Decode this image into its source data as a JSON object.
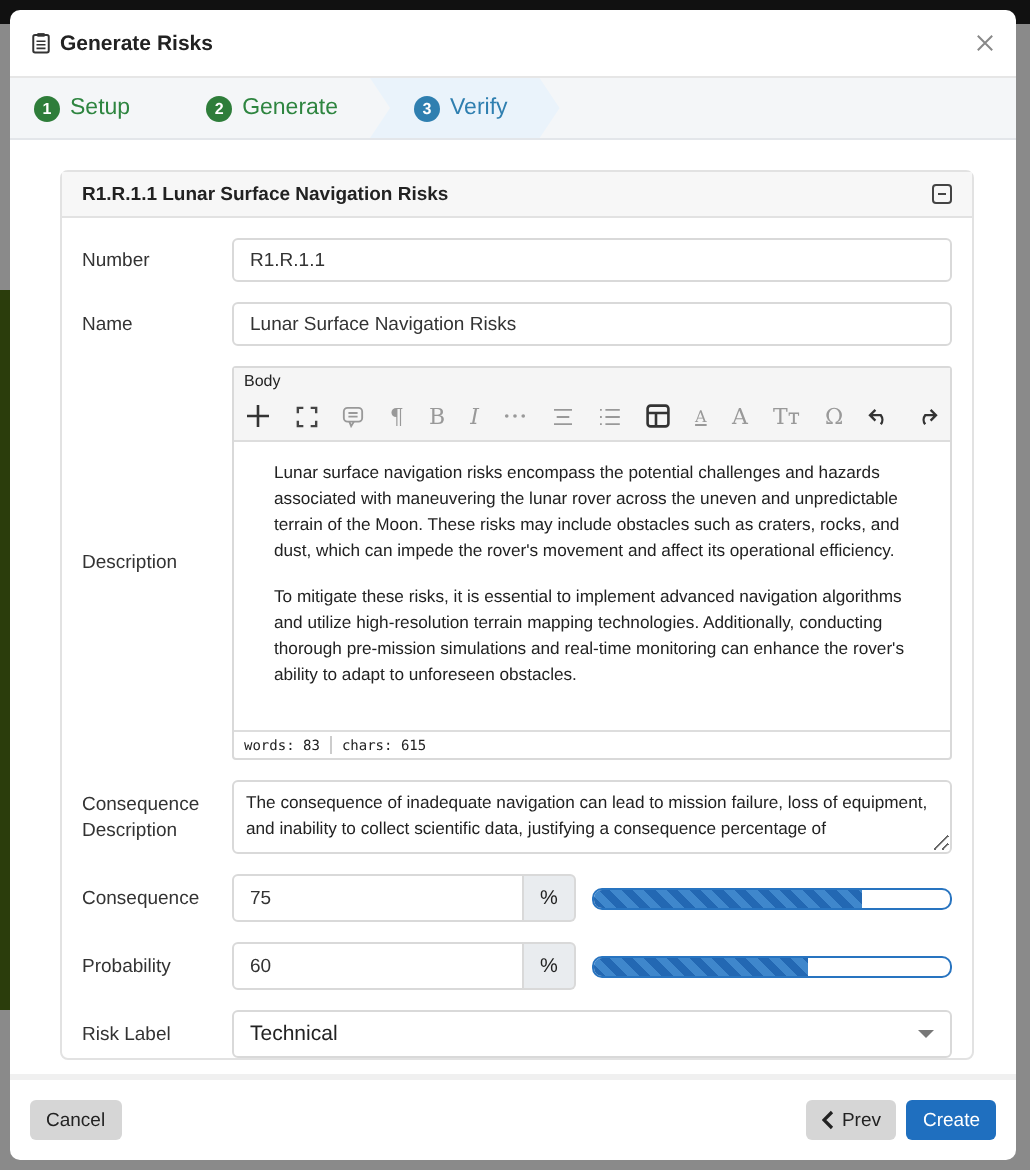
{
  "modal": {
    "title": "Generate Risks"
  },
  "steps": [
    {
      "number": "1",
      "label": "Setup",
      "selected": false
    },
    {
      "number": "2",
      "label": "Generate",
      "selected": false
    },
    {
      "number": "3",
      "label": "Verify",
      "selected": true
    }
  ],
  "card": {
    "title": "R1.R.1.1 Lunar Surface Navigation Risks",
    "expanded": true
  },
  "fields": {
    "number": {
      "label": "Number",
      "value": "R1.R.1.1"
    },
    "name": {
      "label": "Name",
      "value": "Lunar Surface Navigation Risks"
    },
    "description": {
      "label": "Description",
      "editor_label": "Body",
      "toolbar": [
        {
          "kind": "plus"
        },
        {
          "kind": "expand"
        },
        {
          "kind": "comment"
        },
        {
          "kind": "glyph",
          "text": "¶"
        },
        {
          "kind": "glyph",
          "text": "B"
        },
        {
          "kind": "glyph",
          "text": "I",
          "italic": true
        },
        {
          "kind": "more"
        },
        {
          "kind": "align"
        },
        {
          "kind": "list"
        },
        {
          "kind": "table"
        },
        {
          "kind": "glyph",
          "text": "A",
          "underline": true
        },
        {
          "kind": "glyph",
          "text": "A"
        },
        {
          "kind": "glyph",
          "text": "Tт"
        },
        {
          "kind": "glyph",
          "text": "Ω"
        },
        {
          "kind": "undo"
        },
        {
          "kind": "redo"
        }
      ],
      "paragraphs": [
        "Lunar surface navigation risks encompass the potential challenges and hazards associated with maneuvering the lunar rover across the uneven and unpredictable terrain of the Moon. These risks may include obstacles such as craters, rocks, and dust, which can impede the rover's movement and affect its operational efficiency.",
        "To mitigate these risks, it is essential to implement advanced navigation algorithms and utilize high-resolution terrain mapping technologies. Additionally, conducting thorough pre-mission simulations and real-time monitoring can enhance the rover's ability to adapt to unforeseen obstacles."
      ],
      "stats": [
        "words: 83",
        "chars: 615"
      ]
    },
    "consequence_description": {
      "label": "Consequence Description",
      "value": "The consequence of inadequate navigation can lead to mission failure, loss of equipment, and inability to collect scientific data, justifying a consequence percentage of"
    },
    "meters": [
      {
        "label": "Consequence",
        "value": "75",
        "unit": "%",
        "level": 0.75
      },
      {
        "label": "Probability",
        "value": "60",
        "unit": "%",
        "level": 0.6
      }
    ],
    "risk_label": {
      "label": "Risk Label",
      "value": "Technical"
    }
  },
  "footer": {
    "cancel": "Cancel",
    "prev": "Prev",
    "create": "Create"
  }
}
